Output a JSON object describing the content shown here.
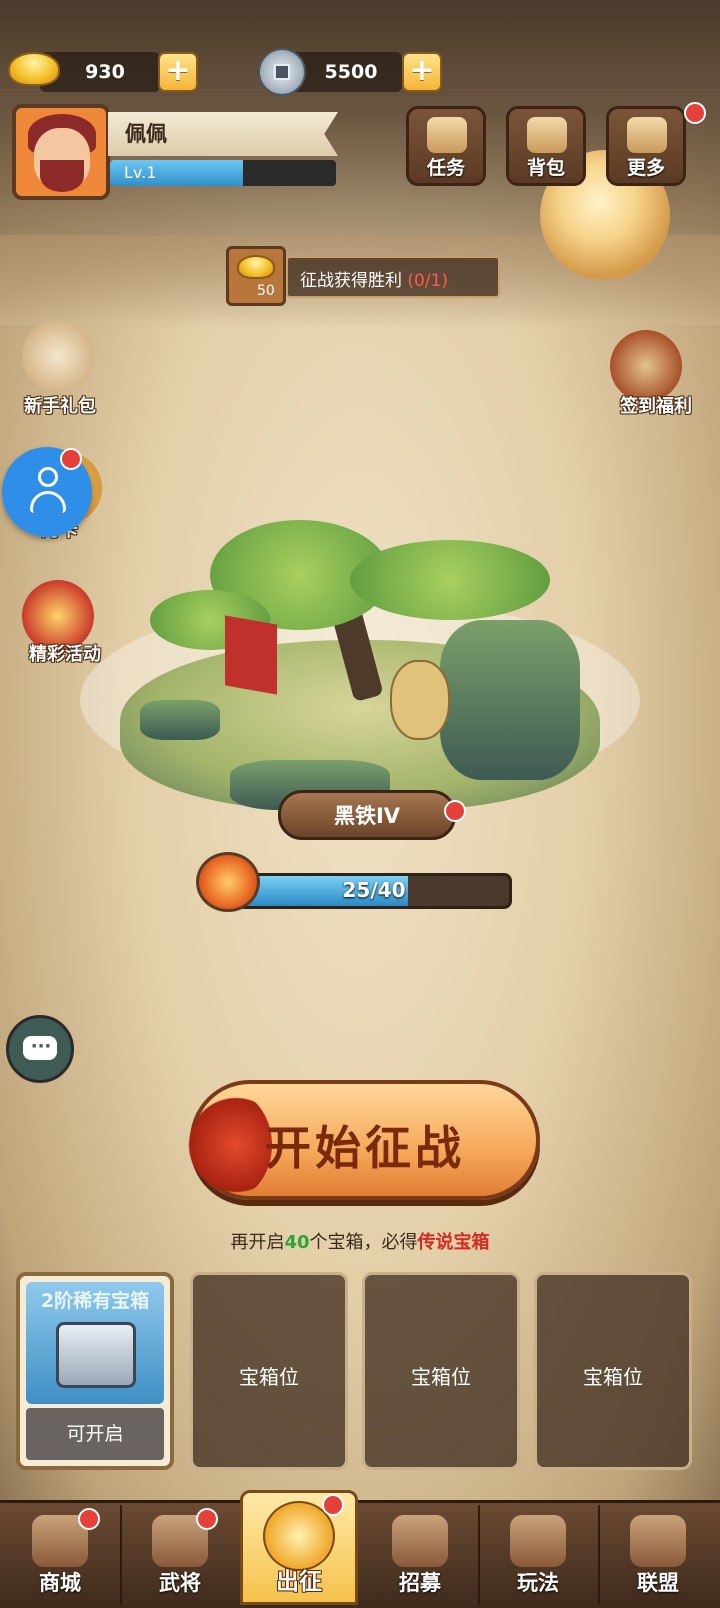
{
  "currency": {
    "gold": "930",
    "coins": "5500"
  },
  "player": {
    "name": "佩佩",
    "level": "Lv.1",
    "exp_fraction": 0.59
  },
  "top_buttons": [
    {
      "label": "任务"
    },
    {
      "label": "背包"
    },
    {
      "label": "更多"
    }
  ],
  "task": {
    "reward": "50",
    "text": "征战获得胜利",
    "progress": "(0/1)"
  },
  "side_left": [
    {
      "label": "新手礼包"
    },
    {
      "label": "月卡"
    },
    {
      "label": "精彩活动"
    }
  ],
  "side_right": {
    "label": "签到福利"
  },
  "rank": {
    "name": "黑铁IV",
    "progress_text": "25/40",
    "progress_value": 25,
    "progress_max": 40
  },
  "start_button": "开始征战",
  "chest_hint": {
    "pre": "再开启",
    "count": "40",
    "mid": "个宝箱，必得",
    "target": "传说宝箱"
  },
  "chests": {
    "first": {
      "title": "2阶稀有宝箱",
      "status": "可开启"
    },
    "empty_label": "宝箱位"
  },
  "nav": [
    {
      "label": "商城"
    },
    {
      "label": "武将"
    },
    {
      "label": "出征"
    },
    {
      "label": "招募"
    },
    {
      "label": "玩法"
    },
    {
      "label": "联盟"
    }
  ],
  "colors": {
    "accent_blue": "#2f8fc9",
    "red_badge": "#e4413a",
    "start_orange": "#f6a85a",
    "legend_red": "#d62a22",
    "count_green": "#2fa23a"
  }
}
